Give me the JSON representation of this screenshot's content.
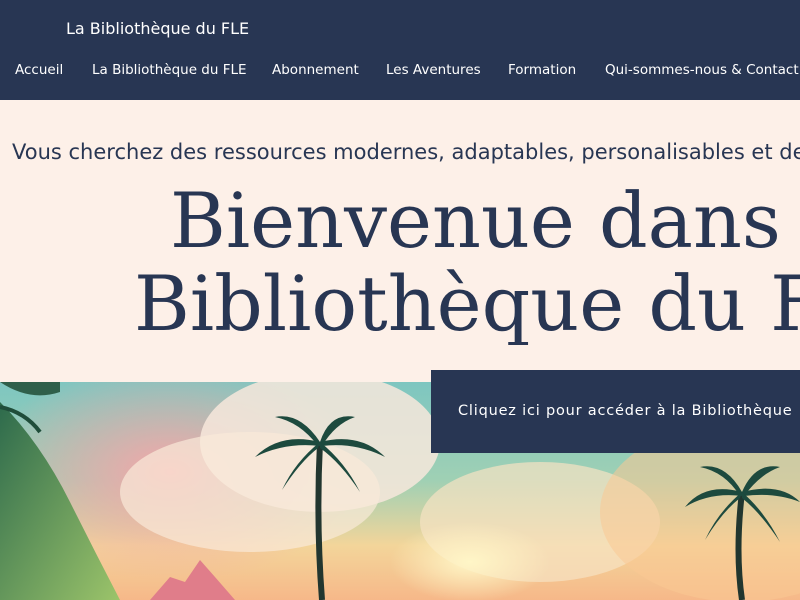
{
  "header": {
    "site_title": "La Bibliothèque du FLE",
    "nav": [
      {
        "label": "Accueil"
      },
      {
        "label": "La Bibliothèque du FLE"
      },
      {
        "label": "Abonnement"
      },
      {
        "label": "Les Aventures"
      },
      {
        "label": "Formation"
      },
      {
        "label": "Qui-sommes-nous & Contact"
      }
    ]
  },
  "intro": {
    "subtitle": "Vous cherchez des ressources modernes, adaptables, personalisables et de",
    "headline_line1": "Bienvenue dans la",
    "headline_line2": "Bibliothèque du FLE"
  },
  "cta": {
    "label": "Cliquez ici pour accéder à la Bibliothèque"
  },
  "colors": {
    "navy": "#283653",
    "cream": "#fdf0e8",
    "white": "#ffffff"
  },
  "hero": {
    "image": "tropical-sunset-palm-trees-illustration"
  }
}
